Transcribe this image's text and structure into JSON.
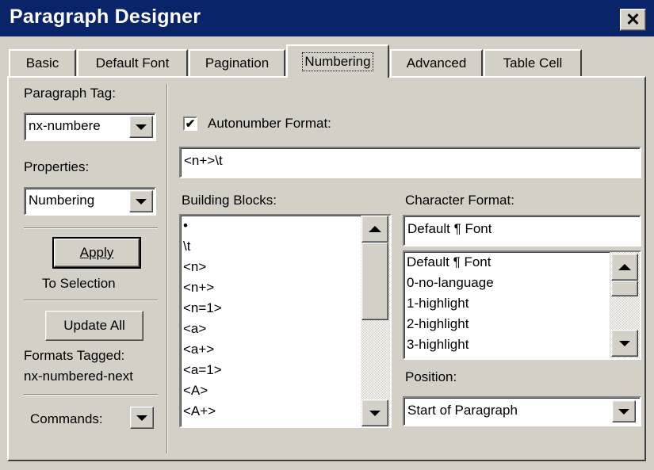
{
  "window": {
    "title": "Paragraph Designer",
    "close_label": "✕"
  },
  "tabs": [
    {
      "label": "Basic"
    },
    {
      "label": "Default Font"
    },
    {
      "label": "Pagination"
    },
    {
      "label": "Numbering"
    },
    {
      "label": "Advanced"
    },
    {
      "label": "Table Cell"
    }
  ],
  "left": {
    "paragraph_tag_label": "Paragraph Tag:",
    "paragraph_tag_value": "nx-numbere",
    "properties_label": "Properties:",
    "properties_value": "Numbering",
    "apply_label": "Apply",
    "apply_sub": "To Selection",
    "update_all_label": "Update All",
    "formats_tagged_label": "Formats Tagged:",
    "formats_tagged_value": "nx-numbered-next",
    "commands_label": "Commands:"
  },
  "numbering": {
    "autonumber_label": "Autonumber Format:",
    "autonumber_checked": true,
    "format_value": "<n+>\\t",
    "building_blocks_label": "Building Blocks:",
    "building_blocks": [
      "•",
      "\\t",
      "<n>",
      "<n+>",
      "<n=1>",
      "<a>",
      "<a+>",
      "<a=1>",
      "<A>",
      "<A+>"
    ],
    "character_format_label": "Character Format:",
    "character_format_value": "Default ¶ Font",
    "character_formats": [
      "Default ¶ Font",
      "0-no-language",
      "1-highlight",
      "2-highlight",
      "3-highlight"
    ],
    "position_label": "Position:",
    "position_value": "Start of Paragraph"
  }
}
